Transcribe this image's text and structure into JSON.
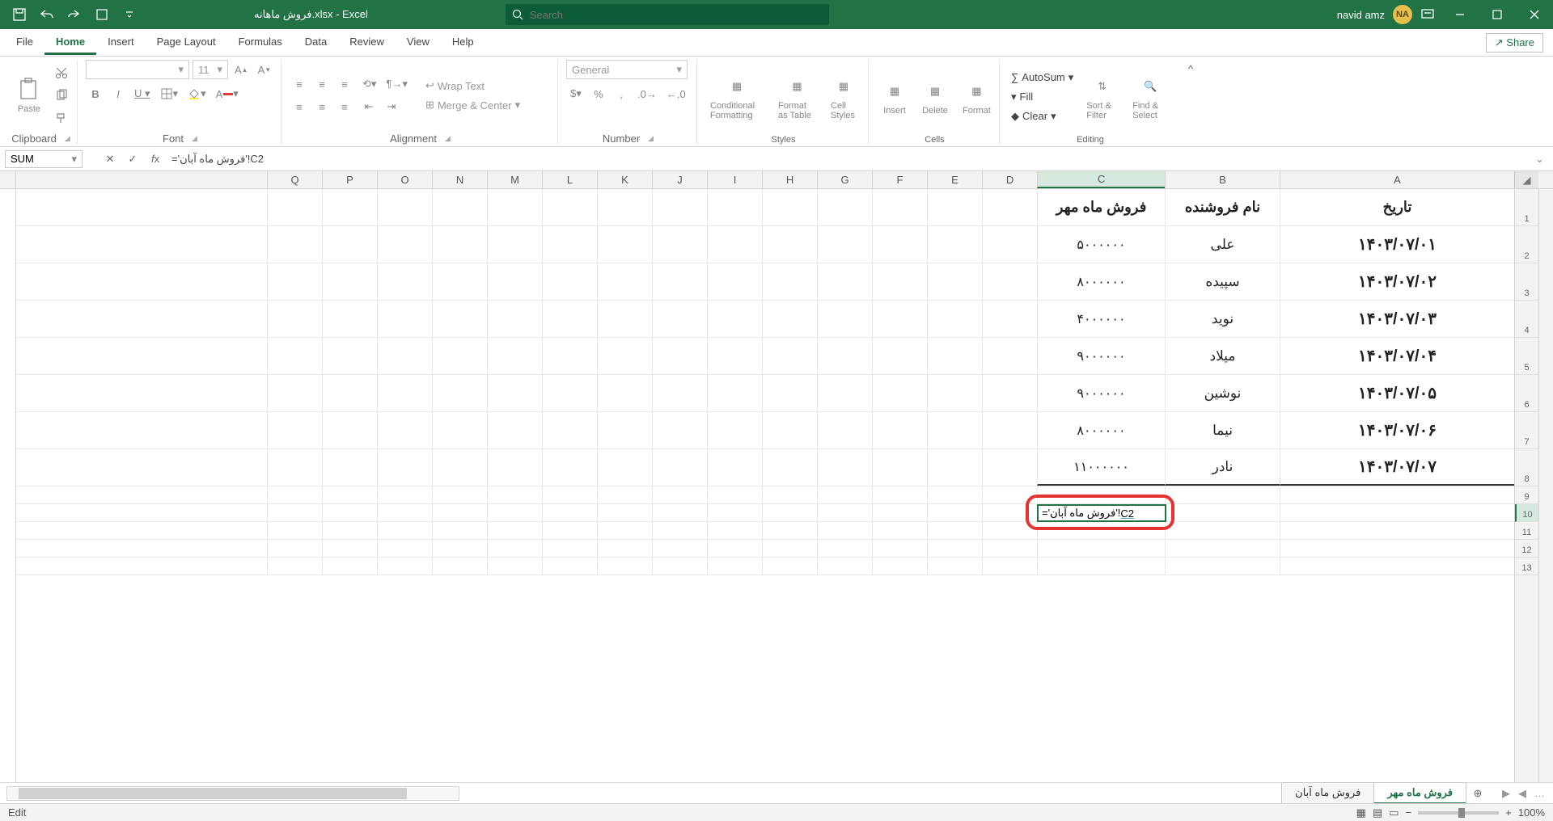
{
  "title_suffix": "xlsx - Excel",
  "file_name_rtl": "فروش ماهانه.",
  "search_placeholder": "Search",
  "account_name": "navid amz",
  "account_initials": "NA",
  "tabs": [
    "File",
    "Home",
    "Insert",
    "Page Layout",
    "Formulas",
    "Data",
    "Review",
    "View",
    "Help"
  ],
  "active_tab": "Home",
  "share_label": "Share",
  "ribbon": {
    "clipboard": {
      "paste": "Paste",
      "label": "Clipboard"
    },
    "font": {
      "family": "",
      "size": "11",
      "label": "Font"
    },
    "alignment": {
      "wrap": "Wrap Text",
      "merge": "Merge & Center",
      "label": "Alignment"
    },
    "number": {
      "format": "General",
      "label": "Number"
    },
    "styles": {
      "cond": "Conditional Formatting",
      "table": "Format as Table",
      "cell": "Cell Styles",
      "label": "Styles"
    },
    "cells": {
      "insert": "Insert",
      "delete": "Delete",
      "format": "Format",
      "label": "Cells"
    },
    "editing": {
      "sum": "AutoSum",
      "fill": "Fill",
      "clear": "Clear",
      "sort": "Sort & Filter",
      "find": "Find & Select",
      "label": "Editing"
    }
  },
  "name_box": "SUM",
  "formula": "='فروش ماه آبان'!C2",
  "edit_text": "='فروش ماه آبان'!C2",
  "columns": [
    "A",
    "B",
    "C",
    "D",
    "E",
    "F",
    "G",
    "H",
    "I",
    "J",
    "K",
    "L",
    "M",
    "N",
    "O",
    "P",
    "Q"
  ],
  "selected_col": "C",
  "selected_row": 10,
  "headers": {
    "A": "تاریخ",
    "B": "نام فروشنده",
    "C": "فروش ماه مهر"
  },
  "rows": [
    {
      "A": "۱۴۰۳/۰۷/۰۱",
      "B": "علی",
      "C": "۵۰۰۰۰۰۰"
    },
    {
      "A": "۱۴۰۳/۰۷/۰۲",
      "B": "سپیده",
      "C": "۸۰۰۰۰۰۰"
    },
    {
      "A": "۱۴۰۳/۰۷/۰۳",
      "B": "نوید",
      "C": "۴۰۰۰۰۰۰"
    },
    {
      "A": "۱۴۰۳/۰۷/۰۴",
      "B": "میلاد",
      "C": "۹۰۰۰۰۰۰"
    },
    {
      "A": "۱۴۰۳/۰۷/۰۵",
      "B": "نوشین",
      "C": "۹۰۰۰۰۰۰"
    },
    {
      "A": "۱۴۰۳/۰۷/۰۶",
      "B": "نیما",
      "C": "۸۰۰۰۰۰۰"
    },
    {
      "A": "۱۴۰۳/۰۷/۰۷",
      "B": "نادر",
      "C": "۱۱۰۰۰۰۰۰"
    }
  ],
  "sheets": [
    "فروش ماه مهر",
    "فروش ماه آبان"
  ],
  "active_sheet": "فروش ماه مهر",
  "status_mode": "Edit",
  "zoom": "100%"
}
